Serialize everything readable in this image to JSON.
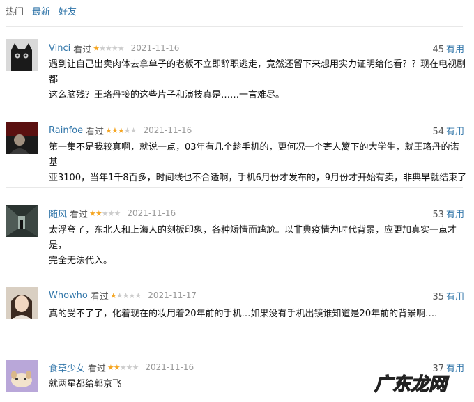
{
  "tabs": [
    "热门",
    "最新",
    "好友"
  ],
  "colors": {
    "link": "#3377aa",
    "star": "#f5a623",
    "star_empty": "#cccccc"
  },
  "watermark": "广东龙网",
  "reviews": [
    {
      "user": "Vinci",
      "status": "看过",
      "rating": 1,
      "date": "2021-11-16",
      "votes": "45",
      "vote_label": "有用",
      "lines": [
        "遇到让自己出卖肉体去拿单子的老板不立即辞职逃走，竟然还留下来想用实力证明给他看？？现在电视剧都",
        "这么脑残？王珞丹接的这些片子和演技真是……一言难尽。"
      ],
      "avatar_icon": "black-cat-avatar"
    },
    {
      "user": "Rainfoe",
      "status": "看过",
      "rating": 3,
      "date": "2021-11-16",
      "votes": "54",
      "vote_label": "有用",
      "lines": [
        "第一集不是我较真啊，就说一点，03年有几个趁手机的，更何况一个寄人篱下的大学生，就王珞丹的诺基",
        "亚3100，当年1千8百多，时间线也不合适啊，手机6月份才发布的，9月份才开始有卖，非典早就结束了"
      ],
      "avatar_icon": "dark-red-figure-avatar"
    },
    {
      "user": "随风",
      "status": "看过",
      "rating": 2,
      "date": "2021-11-16",
      "votes": "53",
      "vote_label": "有用",
      "lines": [
        "太浮夸了，东北人和上海人的刻板印象，各种矫情而尴尬。以非典疫情为时代背景，应更加真实一点才是，",
        "完全无法代入。"
      ],
      "avatar_icon": "corridor-silhouette-avatar"
    },
    {
      "user": "Whowho",
      "status": "看过",
      "rating": 1,
      "date": "2021-11-17",
      "votes": "35",
      "vote_label": "有用",
      "lines": [
        "真的受不了了，化着现在的妆用着20年前的手机…如果没有手机出镜谁知道是20年前的背景啊…."
      ],
      "avatar_icon": "girl-portrait-avatar"
    },
    {
      "user": "食草少女",
      "status": "看过",
      "rating": 2,
      "date": "2021-11-16",
      "votes": "37",
      "vote_label": "有用",
      "lines": [
        "就两星都给郭京飞"
      ],
      "avatar_icon": "dog-on-purple-avatar"
    }
  ]
}
